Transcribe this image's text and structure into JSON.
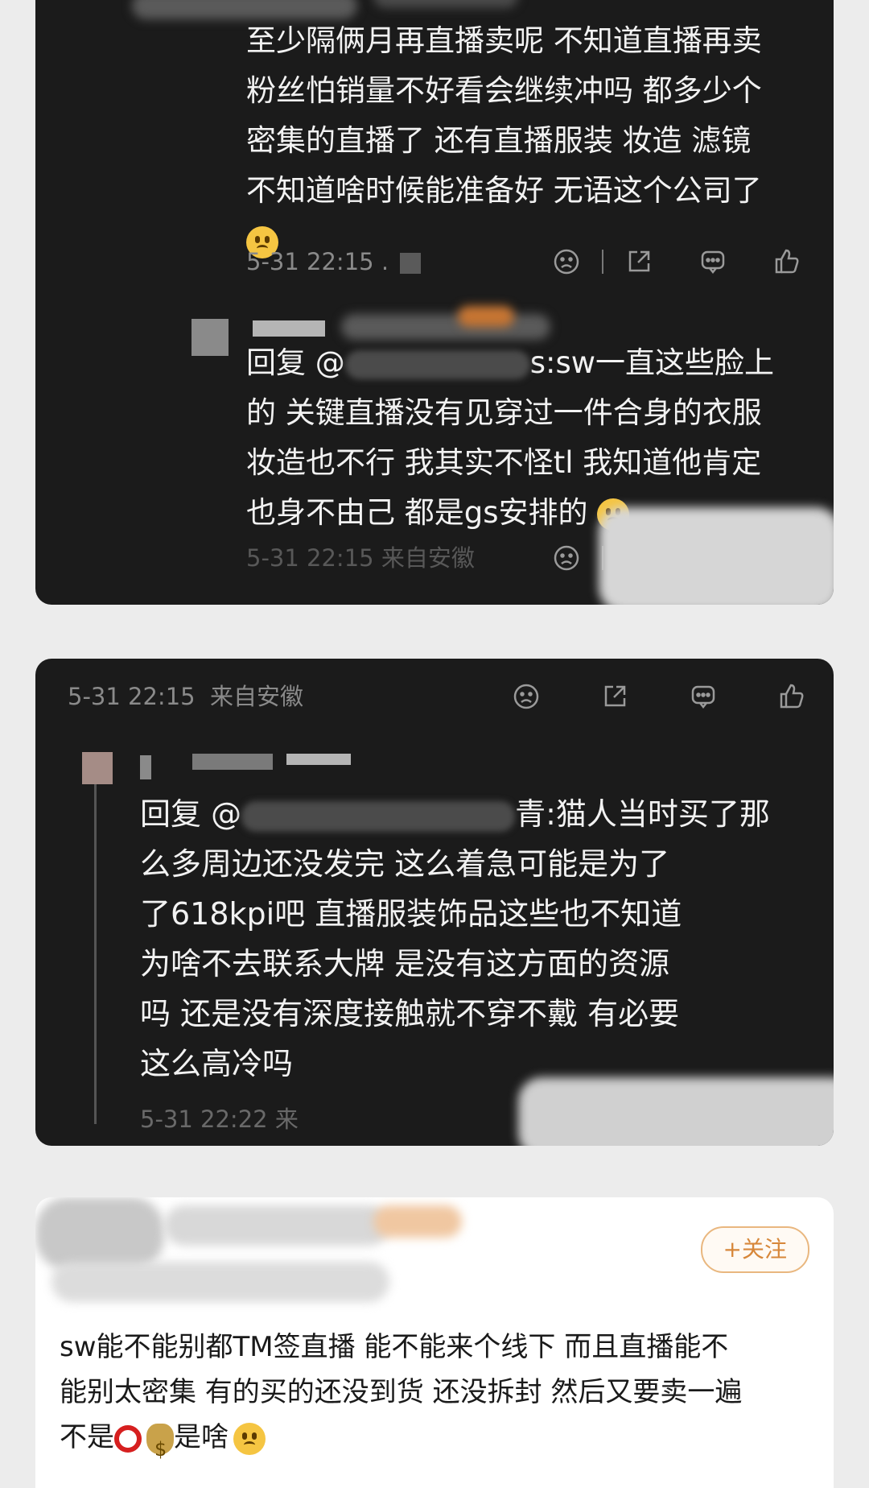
{
  "comment1": {
    "lines": [
      "至少隔俩月再直播卖呢  不知道直播再卖",
      "粉丝怕销量不好看会继续冲吗  都多少个",
      "密集的直播了  还有直播服装  妆造 滤镜",
      "不知道啥时候能准备好  无语这个公司了"
    ],
    "emoji": "upside-down-face",
    "time": "5-31 22:15 .",
    "reply": {
      "prefix": "回复 @",
      "tail": "s:sw一直这些脸上",
      "lines": [
        "的  关键直播没有见穿过一件合身的衣服",
        "妆造也不行  我其实不怪tl  我知道他肯定",
        "也身不由己  都是gs安排的"
      ],
      "emoji": "smiling-face-with-tear",
      "time": "5-31 22:15 来自安徽"
    }
  },
  "comment2": {
    "time": "5-31 22:15",
    "location": "来自安徽",
    "reply": {
      "prefix": "回复 @",
      "tail": "青:猫人当时买了那",
      "lines": [
        "么多周边还没发完  这么着急可能是为了",
        "了618kpi吧  直播服装饰品这些也不知道",
        "为啥不去联系大牌  是没有这方面的资源",
        "吗  还是没有深度接触就不穿不戴  有必要",
        "这么高冷吗"
      ],
      "time": "5-31 22:22 来"
    }
  },
  "post": {
    "follow_label": "+关注",
    "lines": [
      "sw能不能别都TM签直播   能不能来个线下   而且直播能不",
      "能别太密集   有的买的还没到货  还没拆封   然后又要卖一遍"
    ],
    "last_prefix": "不是",
    "last_suffix": "是啥"
  },
  "icons": [
    "dislike-icon",
    "share-icon",
    "comment-icon",
    "like-icon"
  ],
  "colors": {
    "dark_card": "#1b1b1b",
    "follow_border": "#e9b77f",
    "follow_text": "#d7873a"
  }
}
